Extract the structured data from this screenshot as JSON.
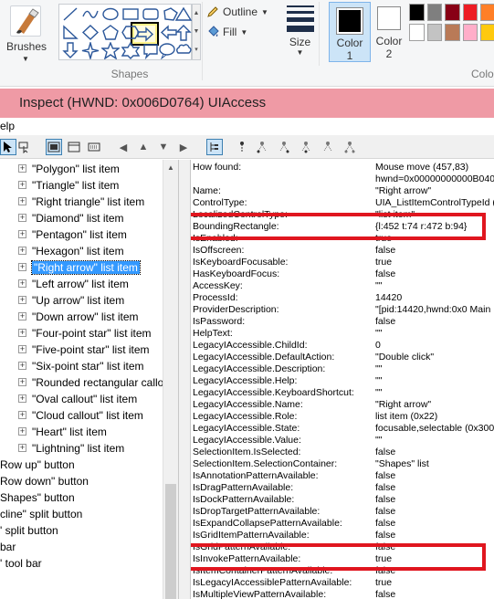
{
  "ribbon": {
    "brushes_label": "Brushes",
    "shapes_label": "Shapes",
    "outline_label": "Outline",
    "fill_label": "Fill",
    "size_label": "Size",
    "color1_label": "Color\n1",
    "color2_label": "Color\n2",
    "colors_label": "Colo",
    "palette_row1": [
      "#000000",
      "#7f7f7f",
      "#880015",
      "#ed1c24",
      "#ff7f27"
    ],
    "palette_row2": [
      "#ffffff",
      "#c3c3c3",
      "#b97a57",
      "#ffaec9",
      "#ffc90e"
    ],
    "accent_color": "#cce4f7"
  },
  "inspect": {
    "title": "Inspect  (HWND: 0x006D0764) UIAccess",
    "title_bar_color": "#ef9aa5",
    "menu_help": "elp",
    "tree_items": [
      {
        "label": "\"Polygon\" list item"
      },
      {
        "label": "\"Triangle\" list item"
      },
      {
        "label": "\"Right triangle\" list item"
      },
      {
        "label": "\"Diamond\" list item"
      },
      {
        "label": "\"Pentagon\" list item"
      },
      {
        "label": "\"Hexagon\" list item"
      },
      {
        "label": "\"Right arrow\" list item",
        "selected": true
      },
      {
        "label": "\"Left arrow\" list item"
      },
      {
        "label": "\"Up arrow\" list item"
      },
      {
        "label": "\"Down arrow\" list item"
      },
      {
        "label": "\"Four-point star\" list item"
      },
      {
        "label": "\"Five-point star\" list item"
      },
      {
        "label": "\"Six-point star\" list item"
      },
      {
        "label": "\"Rounded rectangular callo"
      },
      {
        "label": "\"Oval callout\" list item"
      },
      {
        "label": "\"Cloud callout\" list item"
      },
      {
        "label": "\"Heart\" list item"
      },
      {
        "label": "\"Lightning\" list item"
      }
    ],
    "tree_tail": [
      "Row up\" button",
      "Row down\" button",
      "Shapes\" button",
      "cline\" split button",
      "' split button",
      "bar",
      "' tool bar"
    ],
    "properties": [
      {
        "k": "How found:",
        "v": "Mouse move (457,83)"
      },
      {
        "k": "",
        "v": "hwnd=0x00000000000B040"
      },
      {
        "k": "Name:",
        "v": "\"Right arrow\""
      },
      {
        "k": "ControlType:",
        "v": "UIA_ListItemControlTypeId ("
      },
      {
        "k": "LocalizedControlType:",
        "v": "\"list item\""
      },
      {
        "k": "BoundingRectangle:",
        "v": "{l:452 t:74 r:472 b:94}"
      },
      {
        "k": "IsEnabled:",
        "v": "true"
      },
      {
        "k": "IsOffscreen:",
        "v": "false"
      },
      {
        "k": "IsKeyboardFocusable:",
        "v": "true"
      },
      {
        "k": "HasKeyboardFocus:",
        "v": "false"
      },
      {
        "k": "AccessKey:",
        "v": "\"\""
      },
      {
        "k": "ProcessId:",
        "v": "14420"
      },
      {
        "k": "ProviderDescription:",
        "v": "\"[pid:14420,hwnd:0x0 Main"
      },
      {
        "k": "IsPassword:",
        "v": "false"
      },
      {
        "k": "HelpText:",
        "v": "\"\""
      },
      {
        "k": "LegacyIAccessible.ChildId:",
        "v": "0"
      },
      {
        "k": "LegacyIAccessible.DefaultAction:",
        "v": "\"Double click\""
      },
      {
        "k": "LegacyIAccessible.Description:",
        "v": "\"\""
      },
      {
        "k": "LegacyIAccessible.Help:",
        "v": "\"\""
      },
      {
        "k": "LegacyIAccessible.KeyboardShortcut:",
        "v": "\"\""
      },
      {
        "k": "LegacyIAccessible.Name:",
        "v": "\"Right arrow\""
      },
      {
        "k": "LegacyIAccessible.Role:",
        "v": "list item (0x22)"
      },
      {
        "k": "LegacyIAccessible.State:",
        "v": "focusable,selectable (0x300"
      },
      {
        "k": "LegacyIAccessible.Value:",
        "v": "\"\""
      },
      {
        "k": "SelectionItem.IsSelected:",
        "v": "false"
      },
      {
        "k": "SelectionItem.SelectionContainer:",
        "v": "\"Shapes\" list"
      },
      {
        "k": "IsAnnotationPatternAvailable:",
        "v": "false"
      },
      {
        "k": "IsDragPatternAvailable:",
        "v": "false"
      },
      {
        "k": "IsDockPatternAvailable:",
        "v": "false"
      },
      {
        "k": "IsDropTargetPatternAvailable:",
        "v": "false"
      },
      {
        "k": "IsExpandCollapsePatternAvailable:",
        "v": "false"
      },
      {
        "k": "IsGridItemPatternAvailable:",
        "v": "false"
      },
      {
        "k": "IsGridPatternAvailable:",
        "v": "false"
      },
      {
        "k": "IsInvokePatternAvailable:",
        "v": "true"
      },
      {
        "k": "IsItemContainerPatternAvailable:",
        "v": "false"
      },
      {
        "k": "IsLegacyIAccessiblePatternAvailable:",
        "v": "true"
      },
      {
        "k": "IsMultipleViewPatternAvailable:",
        "v": "false"
      }
    ],
    "highlight_color": "#e0161f"
  }
}
